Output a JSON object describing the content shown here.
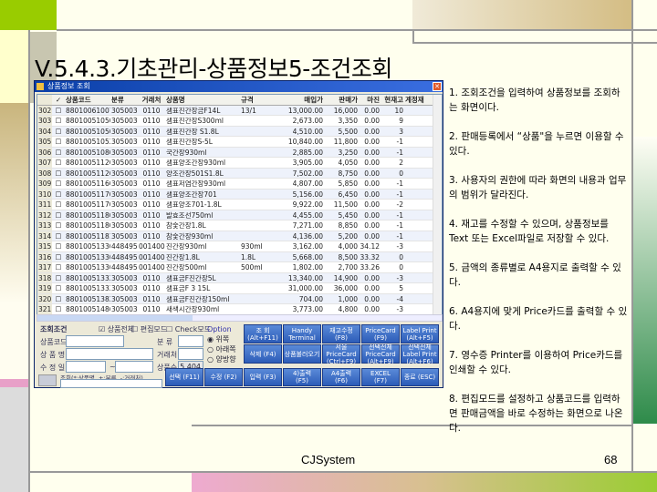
{
  "slide": {
    "title": "V.5.4.3.기초관리-상품정보5-조건조회",
    "footer_left": "CJSystem",
    "page_number": "68",
    "notes": [
      "1. 조회조건을 입력하여 상품정보를 조회하는 화면이다.",
      "2. 판매등록에서 “상품\"을 누르면 이용할 수 있다.",
      "3. 사용자의 권한에 따라 화면의 내용과 업무의 범위가 달라진다.",
      "4. 재고를 수정할 수 있으며, 상품정보를 Text 또는 Excel파일로 저장할 수 있다.",
      "5. 금액의 종류별로 A4용지로 출력할 수 있다.",
      "6. A4용지에 맞게 Price카드를 출력할 수 있다.",
      "7. 영수증 Printer를 이용하여 Price카드를 인쇄할 수 있다.",
      "8. 편집모드를 설정하고 상품코드를 입력하면 판매금액을 바로 수정하는 화면으로 나온다."
    ]
  },
  "window": {
    "title": "상품정보 조회",
    "columns": [
      "",
      "✓",
      "상품코드",
      "분류",
      "거래처",
      "상품명",
      "규격",
      "매입가",
      "판매가",
      "마진",
      "현재고",
      "계정재"
    ],
    "rows": [
      [
        "302",
        "☐",
        "8801006100736",
        "305003",
        "0110",
        "샘표진간장금F14L",
        "13/1",
        "13,000.00",
        "16,000",
        "0.00",
        "10",
        ""
      ],
      [
        "303",
        "☐",
        "8801005105002",
        "305003",
        "0110",
        "샘표진간장S300ml",
        "",
        "2,673.00",
        "3,350",
        "0.00",
        "9",
        ""
      ],
      [
        "304",
        "☐",
        "8801005105000",
        "305003",
        "0110",
        "샘표진간장 S1.8L",
        "",
        "4,510.00",
        "5,500",
        "0.00",
        "3",
        ""
      ],
      [
        "305",
        "☐",
        "8801005105217",
        "305003",
        "0110",
        "샘표진간장S-5L",
        "",
        "10,840.00",
        "11,800",
        "0.00",
        "-1",
        ""
      ],
      [
        "306",
        "☐",
        "8801005108000",
        "305003",
        "0110",
        "국간장930ml",
        "",
        "2,885.00",
        "3,250",
        "0.00",
        "-1",
        ""
      ],
      [
        "307",
        "☐",
        "8801005112000",
        "305003",
        "0110",
        "샘표양조간장930ml",
        "",
        "3,905.00",
        "4,050",
        "0.00",
        "2",
        ""
      ],
      [
        "308",
        "☐",
        "8801005112024",
        "305003",
        "0110",
        "양조간장501S1.8L",
        "",
        "7,502.00",
        "8,750",
        "0.00",
        "0",
        ""
      ],
      [
        "309",
        "☐",
        "8801005116022",
        "305003",
        "0110",
        "샘표저염간장930ml",
        "",
        "4,807.00",
        "5,850",
        "0.00",
        "-1",
        ""
      ],
      [
        "310",
        "☐",
        "8801005117005",
        "305003",
        "0110",
        "샘표양조간장701",
        "",
        "5,156.00",
        "6,450",
        "0.00",
        "-1",
        ""
      ],
      [
        "311",
        "☐",
        "8801005117081",
        "305003",
        "0110",
        "샘표양조701-1.8L",
        "",
        "9,922.00",
        "11,500",
        "0.00",
        "-2",
        ""
      ],
      [
        "312",
        "☐",
        "8801005118002",
        "305003",
        "0110",
        "발효조선750ml",
        "",
        "4,455.00",
        "5,450",
        "0.00",
        "-1",
        ""
      ],
      [
        "313",
        "☐",
        "8801005118076",
        "305003",
        "0110",
        "참숯간장1.8L",
        "",
        "7,271.00",
        "8,850",
        "0.00",
        "-1",
        ""
      ],
      [
        "314",
        "☐",
        "8801005118168",
        "305003",
        "0110",
        "참숯간장930ml",
        "",
        "4,136.00",
        "5,200",
        "0.00",
        "-1",
        ""
      ],
      [
        "315",
        "☐",
        "8801005133005",
        "448495",
        "001400",
        "진간장930ml",
        "930ml",
        "3,162.00",
        "4,000",
        "34.12",
        "-3",
        ""
      ],
      [
        "316",
        "☐",
        "8801005133029",
        "448495",
        "001400",
        "진간장1.8L",
        "1.8L",
        "5,668.00",
        "8,500",
        "33.32",
        "0",
        ""
      ],
      [
        "317",
        "☐",
        "8801005133036",
        "448495",
        "001400",
        "진간장500ml",
        "500ml",
        "1,802.00",
        "2,700",
        "33.26",
        "0",
        ""
      ],
      [
        "318",
        "☐",
        "8801005133210",
        "305003",
        "0110",
        "샘표금F진간장5L",
        "",
        "13,340.00",
        "14,900",
        "0.00",
        "-3",
        ""
      ],
      [
        "319",
        "☐",
        "8801005133272",
        "305003",
        "0110",
        "샘표금F 3 15L",
        "",
        "31,000.00",
        "36,000",
        "0.00",
        "5",
        ""
      ],
      [
        "320",
        "☐",
        "8801005138289",
        "305003",
        "0110",
        "샘표금F진간장150ml",
        "",
        "704.00",
        "1,000",
        "0.00",
        "-4",
        ""
      ],
      [
        "321",
        "☐",
        "8801005148653",
        "305003",
        "0110",
        "새색시간장930ml",
        "",
        "3,773.00",
        "4,800",
        "0.00",
        "-3",
        ""
      ]
    ],
    "filter": {
      "section_label": "조회조건",
      "check_all": "☑ 상품전체",
      "check_edit": "☐ 편집모드",
      "check_check": "☐ Check모드",
      "code_label": "상품코드",
      "name_label": "상 품 명",
      "date_label": "수 정 일",
      "date_sep": "~",
      "cat_label": "분   류",
      "vendor_label": "거래처",
      "count_label": "상품수",
      "count_value": "5,404",
      "memo_label": "조회(*:상품명, +:분류, -:거래처)"
    },
    "option": {
      "label": "Option",
      "items": [
        "◉ 위쪽",
        "○ 아래쪽",
        "○ 양방향"
      ]
    },
    "buttons": [
      [
        "조 회",
        "(Alt+F11)"
      ],
      [
        "Handy",
        "Terminal"
      ],
      [
        "재고수정",
        "(F8)"
      ],
      [
        "PriceCard",
        "(F9)"
      ],
      [
        "Label Print",
        "(Alt+F5)"
      ],
      [
        "삭제 (F4)",
        ""
      ],
      [
        "상품불러오기",
        ""
      ],
      [
        "서울PriceCard",
        "(Ctrl+F9)"
      ],
      [
        "선택전체 PriceCard",
        "(Alt+F9)"
      ],
      [
        "선택전체 Label Print",
        "(Alt+F6)"
      ],
      [
        "선택 (F11)",
        ""
      ],
      [
        "수정 (F2)",
        ""
      ],
      [
        "입력 (F3)",
        ""
      ],
      [
        "4)출력",
        "(F5)"
      ],
      [
        "A4출력",
        "(F6)"
      ],
      [
        "EXCEL",
        "(F7)"
      ],
      [
        "종료 (ESC)",
        ""
      ]
    ]
  }
}
